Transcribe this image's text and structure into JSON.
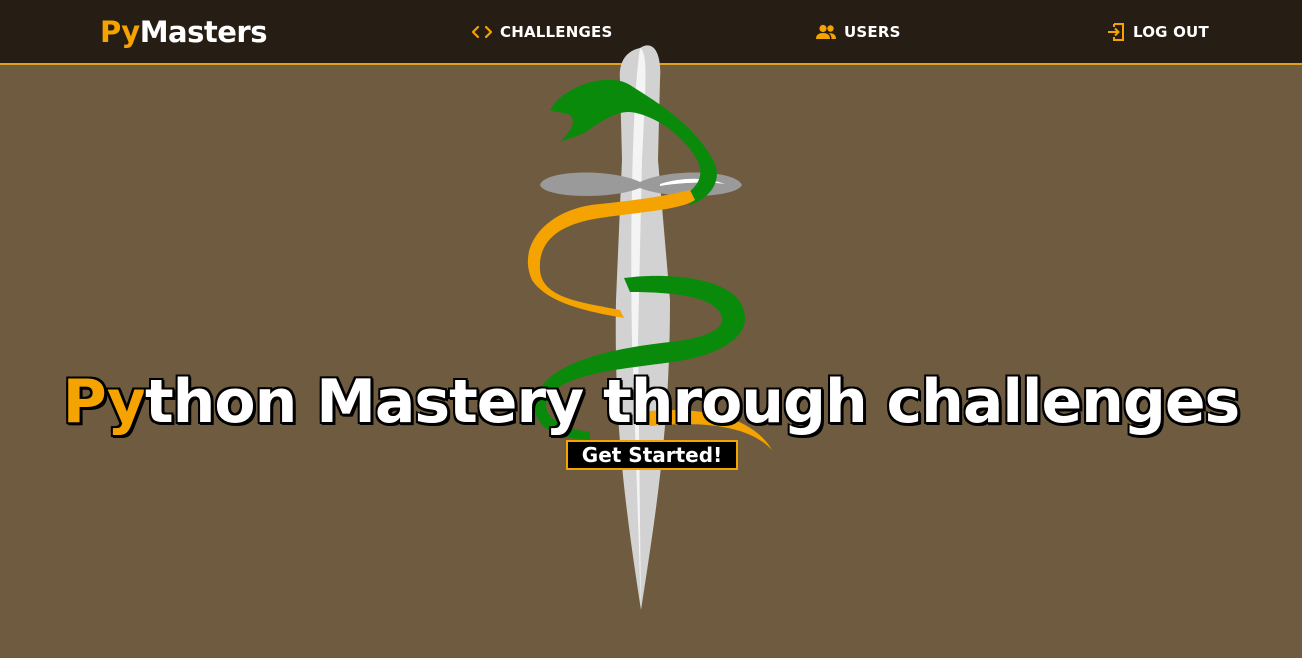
{
  "nav": {
    "brand_accent": "Py",
    "brand_rest": "Masters",
    "links": [
      {
        "label": "CHALLENGES",
        "icon": "code-icon"
      },
      {
        "label": "USERS",
        "icon": "users-icon"
      },
      {
        "label": "LOG OUT",
        "icon": "logout-icon"
      }
    ]
  },
  "hero": {
    "title_accent": "Py",
    "title_rest": "thon Mastery through challenges",
    "cta_label": "Get Started!",
    "art": "python-sword-logo"
  },
  "colors": {
    "background": "#6f5c40",
    "navbar": "#261e14",
    "accent": "#f5a300",
    "snake_green": "#0a8a0a"
  }
}
